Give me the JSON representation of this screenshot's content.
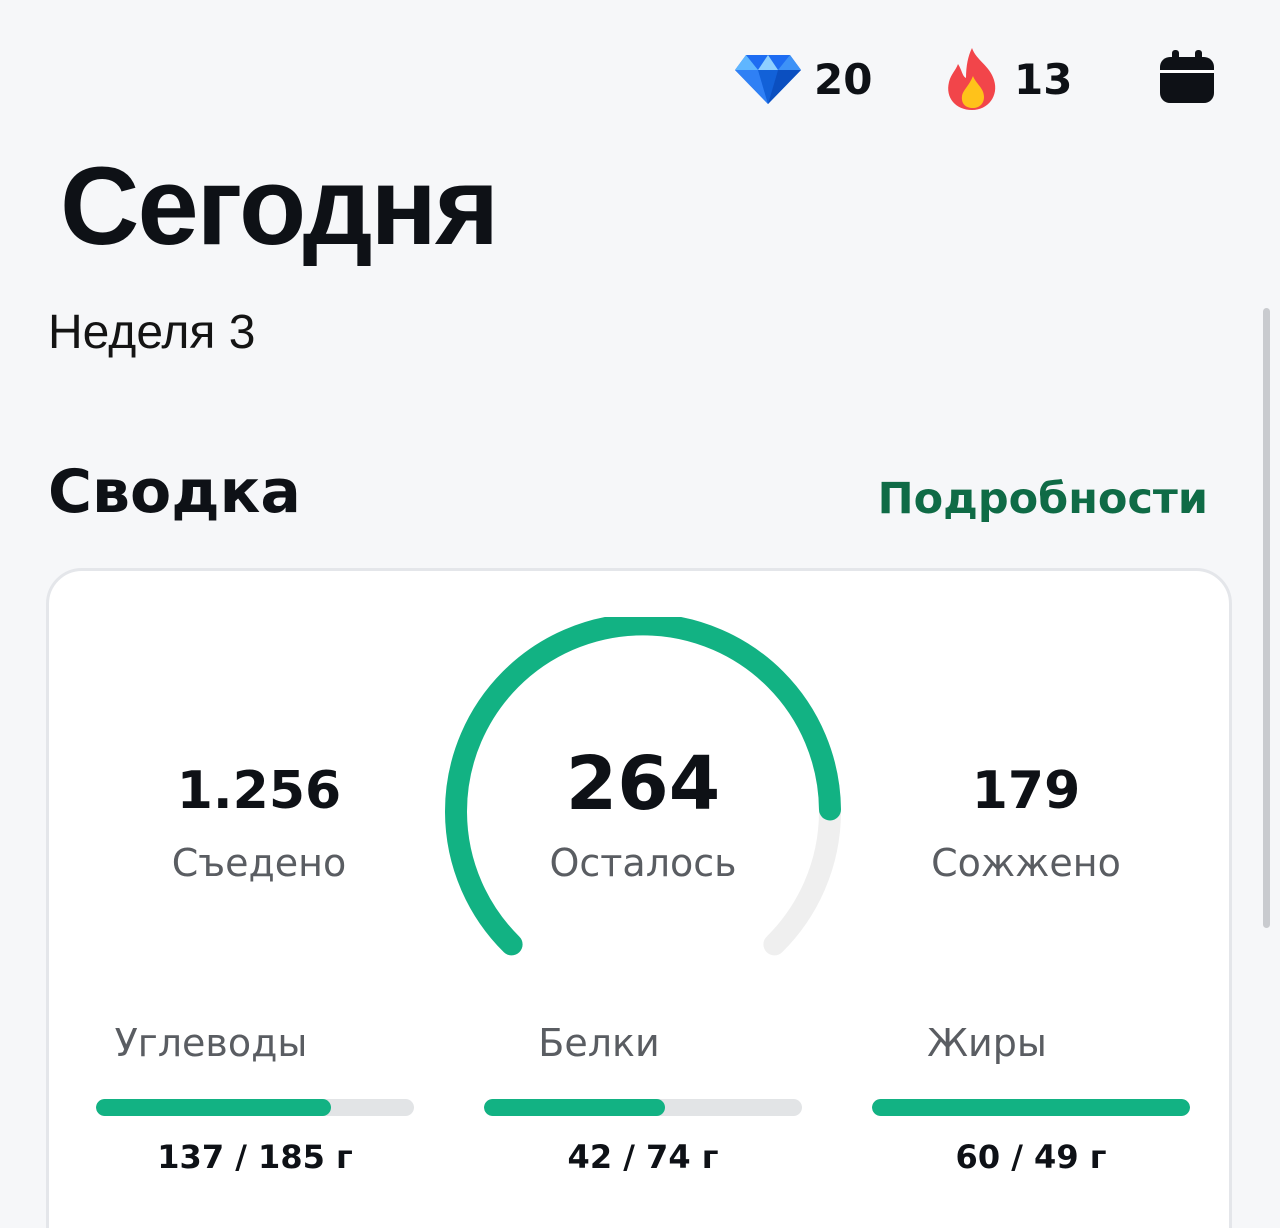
{
  "header": {
    "gems": {
      "icon": "diamond-icon",
      "value": "20"
    },
    "streak": {
      "icon": "fire-icon",
      "value": "13"
    },
    "calendar": {
      "icon": "calendar-icon"
    }
  },
  "page": {
    "title": "Сегодня",
    "subtitle": "Неделя 3"
  },
  "summary": {
    "title": "Сводка",
    "details_label": "Подробности",
    "eaten": {
      "value": "1.256",
      "label": "Съедено"
    },
    "remaining": {
      "value": "264",
      "label": "Осталось",
      "progress_fraction": 0.83
    },
    "burned": {
      "value": "179",
      "label": "Сожжено"
    },
    "macros": {
      "carbs": {
        "label": "Углеводы",
        "value": "137 / 185 г",
        "progress_percent": 74
      },
      "protein": {
        "label": "Белки",
        "value": "42 / 74 г",
        "progress_percent": 57
      },
      "fat": {
        "label": "Жиры",
        "value": "60 / 49 г",
        "progress_percent": 100
      }
    }
  },
  "colors": {
    "accent": "#12b283",
    "link": "#0f6b46",
    "track": "#e2e4e6",
    "gauge_track": "#efefef"
  }
}
